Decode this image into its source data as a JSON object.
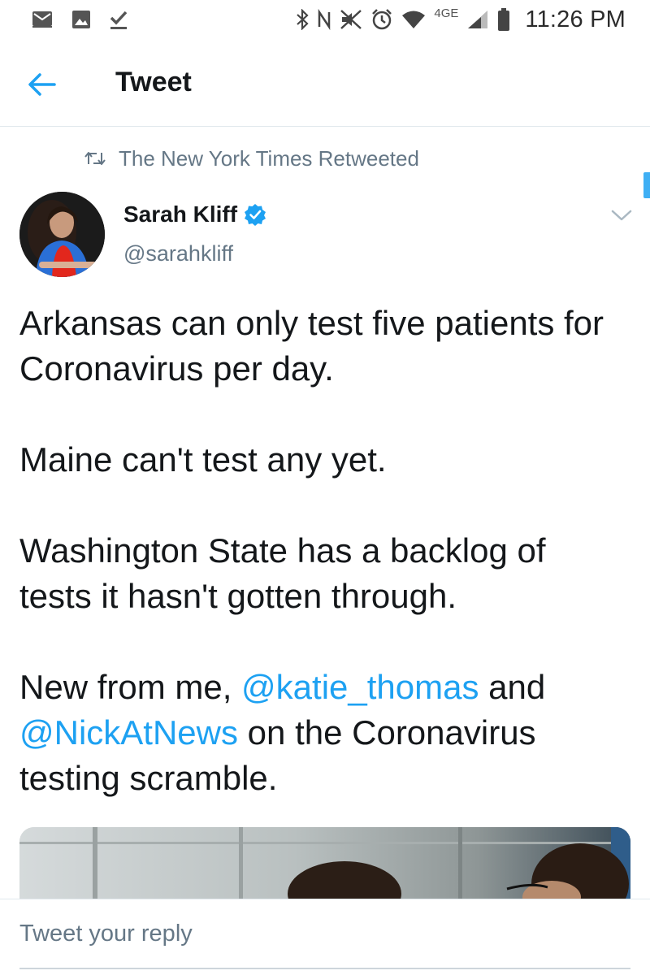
{
  "status_bar": {
    "time": "11:26 PM",
    "network": "4GE",
    "left_icons": [
      "mail-icon",
      "image-icon",
      "check-download-icon"
    ],
    "right_icons": [
      "bluetooth-icon",
      "nfc-icon",
      "mute-icon",
      "alarm-icon",
      "wifi-icon",
      "signal-icon",
      "battery-icon"
    ]
  },
  "header": {
    "title": "Tweet",
    "back_icon": "arrow-left-icon"
  },
  "retweet": {
    "text": "The New York Times Retweeted",
    "icon": "retweet-icon"
  },
  "author": {
    "name": "Sarah Kliff",
    "handle": "@sarahkliff",
    "verified": true
  },
  "tweet": {
    "p1": "Arkansas can only test five patients for Coronavirus per day.",
    "p2": "Maine can't test any yet.",
    "p3": "Washington State has a backlog of tests it hasn't gotten through.",
    "p4_start": "New from me, ",
    "mention1": "@katie_thomas",
    "p4_mid": " and",
    "mention2": "@NickAtNews",
    "p4_end": " on the Coronavirus testing scramble."
  },
  "reply": {
    "placeholder": "Tweet your reply"
  },
  "colors": {
    "accent": "#1da1f2",
    "secondary_text": "#657786",
    "text": "#14171a",
    "divider": "#e1e8ed"
  }
}
